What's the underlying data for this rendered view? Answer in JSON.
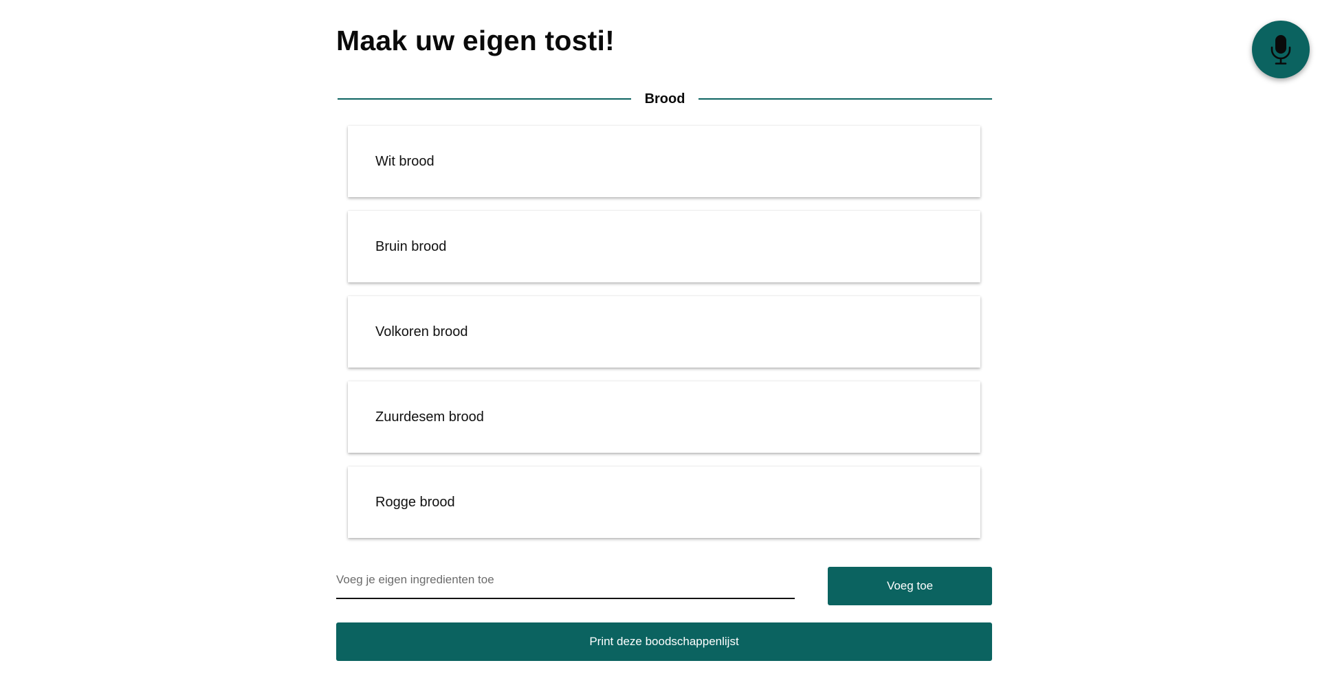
{
  "header": {
    "title": "Maak uw eigen tosti!"
  },
  "section": {
    "label": "Brood",
    "options": [
      {
        "label": "Wit brood"
      },
      {
        "label": "Bruin brood"
      },
      {
        "label": "Volkoren brood"
      },
      {
        "label": "Zuurdesem brood"
      },
      {
        "label": "Rogge brood"
      }
    ]
  },
  "custom_ingredient": {
    "placeholder": "Voeg je eigen ingredienten toe",
    "value": "",
    "add_label": "Voeg toe"
  },
  "actions": {
    "print_label": "Print deze boodschappenlijst"
  },
  "voice": {
    "icon": "microphone-icon"
  },
  "colors": {
    "accent": "#0b6360",
    "background": "#ffffff",
    "text": "#111111"
  }
}
